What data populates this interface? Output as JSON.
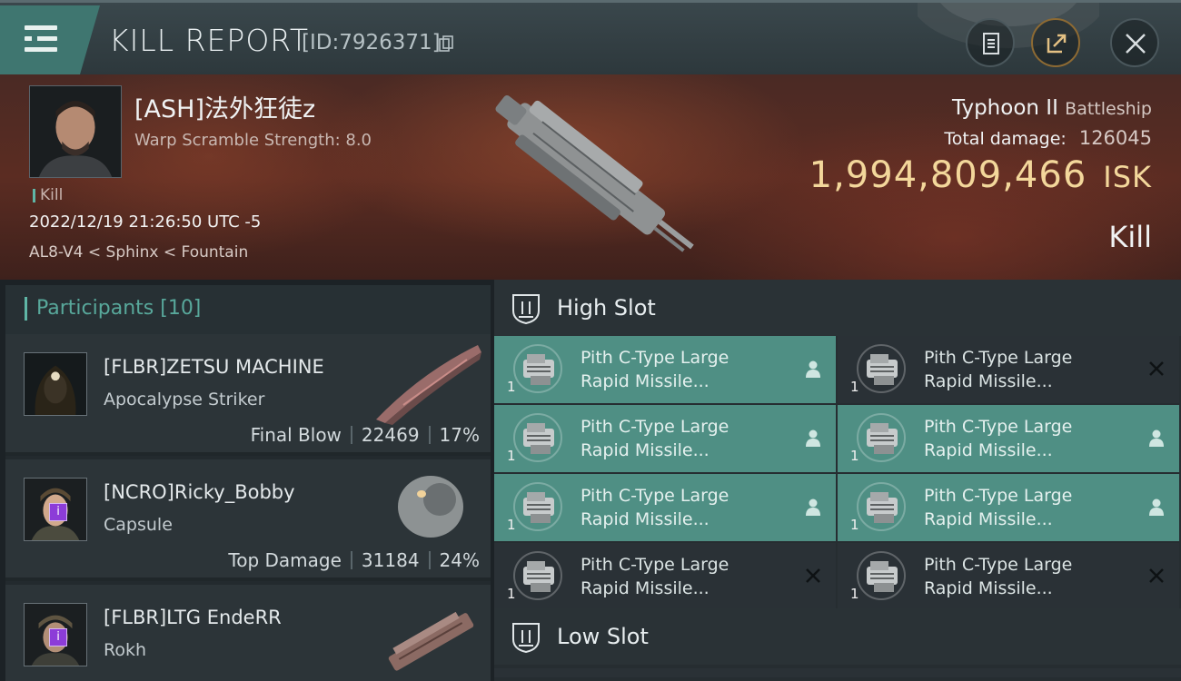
{
  "header": {
    "title": "KILL REPORT",
    "report_id": "[ID:7926371]"
  },
  "victim": {
    "pilot": "[ASH]法外狂徒z",
    "warp_scramble": "Warp Scramble Strength: 8.0",
    "tag": "Kill",
    "timestamp": "2022/12/19 21:26:50 UTC -5",
    "location": "AL8-V4 < Sphinx < Fountain",
    "ship": "Typhoon II",
    "ship_class": "Battleship",
    "total_damage_label": "Total damage:",
    "total_damage": "126045",
    "isk_value": "1,994,809,466",
    "isk_unit": "ISK",
    "result": "Kill"
  },
  "participants": {
    "label": "Participants",
    "count": "[10]",
    "items": [
      {
        "name": "[FLBR]ZETSU MACHINE",
        "ship": "Apocalypse Striker",
        "role": "Final Blow",
        "damage": "22469",
        "percent": "17%"
      },
      {
        "name": "[NCRO]Ricky_Bobby",
        "ship": "Capsule",
        "role": "Top Damage",
        "damage": "31184",
        "percent": "24%"
      },
      {
        "name": "[FLBR]LTG EndeRR",
        "ship": "Rokh"
      }
    ]
  },
  "high_slot": {
    "label": "High Slot",
    "modules": [
      {
        "line1": "Pith C-Type Large",
        "line2": "Rapid Missile...",
        "qty": "1",
        "status": "person-icon",
        "fitted": true
      },
      {
        "line1": "Pith C-Type Large",
        "line2": "Rapid Missile...",
        "qty": "1",
        "status": "x-icon",
        "fitted": false
      },
      {
        "line1": "Pith C-Type Large",
        "line2": "Rapid Missile...",
        "qty": "1",
        "status": "person-icon",
        "fitted": true
      },
      {
        "line1": "Pith C-Type Large",
        "line2": "Rapid Missile...",
        "qty": "1",
        "status": "person-icon",
        "fitted": true
      },
      {
        "line1": "Pith C-Type Large",
        "line2": "Rapid Missile...",
        "qty": "1",
        "status": "person-icon",
        "fitted": true
      },
      {
        "line1": "Pith C-Type Large",
        "line2": "Rapid Missile...",
        "qty": "1",
        "status": "person-icon",
        "fitted": true
      },
      {
        "line1": "Pith C-Type Large",
        "line2": "Rapid Missile...",
        "qty": "1",
        "status": "x-icon",
        "fitted": false
      },
      {
        "line1": "Pith C-Type Large",
        "line2": "Rapid Missile...",
        "qty": "1",
        "status": "x-icon",
        "fitted": false
      }
    ]
  },
  "low_slot": {
    "label": "Low Slot"
  },
  "colors": {
    "accent": "#5fb6a6",
    "fitted_bg": "#4f8f84",
    "isk": "#f3d79b",
    "badge": "#8c3cd8"
  }
}
